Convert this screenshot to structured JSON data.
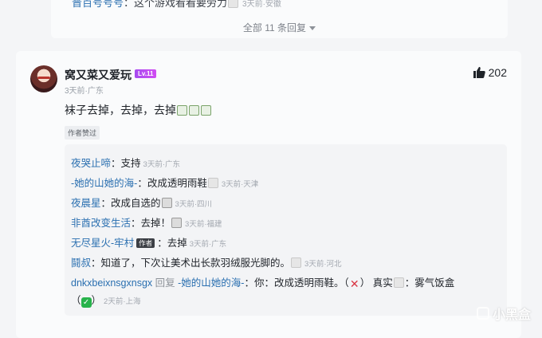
{
  "previous_thread": {
    "reply": {
      "user": "晋百号号号",
      "text": "：这个游戏看看要劳力",
      "time": "3天前·安徽"
    },
    "show_all": "全部 11 条回复"
  },
  "comment": {
    "username": "窝又菜又爱玩",
    "level": "Lv.11",
    "meta": "3天前·广东",
    "likes": "202",
    "text": "袜子去掉，去掉，去掉",
    "badge": "作者赞过",
    "replies": [
      {
        "user": "夜哭止啼",
        "text": "：支持",
        "time": "3天前·广东"
      },
      {
        "user": "-她的山她的海-",
        "text": "：改成透明雨鞋",
        "time": "3天前·天津"
      },
      {
        "user": "夜晨星",
        "text": "：改成自选的",
        "time": "3天前·四川"
      },
      {
        "user": "非酋改变生活",
        "text": "：去掉！",
        "time": "3天前·福建"
      },
      {
        "user": "无尽星火-牢村",
        "author_tag": "作者",
        "text": "：去掉",
        "time": "3天前·广东"
      },
      {
        "user": "鬪叔",
        "text": "：知道了，下次让美术出长款羽绒服光脚的。",
        "time": "3天前·河北"
      },
      {
        "user": "dnkxbeixnsgxnsgx",
        "reply_word": "回复",
        "reply_to": "-她的山她的海-",
        "text": "：你：改成透明雨鞋。（",
        "text_b": "） 真实",
        "text_c": "：雾气饭盒",
        "text_d": "（",
        "text_e": "）",
        "time": "2天前·上海"
      }
    ]
  },
  "watermark": "小黑盒",
  "colors": {
    "username_link": "#2a6fb0",
    "level_badge": "#b94cf2",
    "check": "#27b34b",
    "cross": "#d93644"
  }
}
